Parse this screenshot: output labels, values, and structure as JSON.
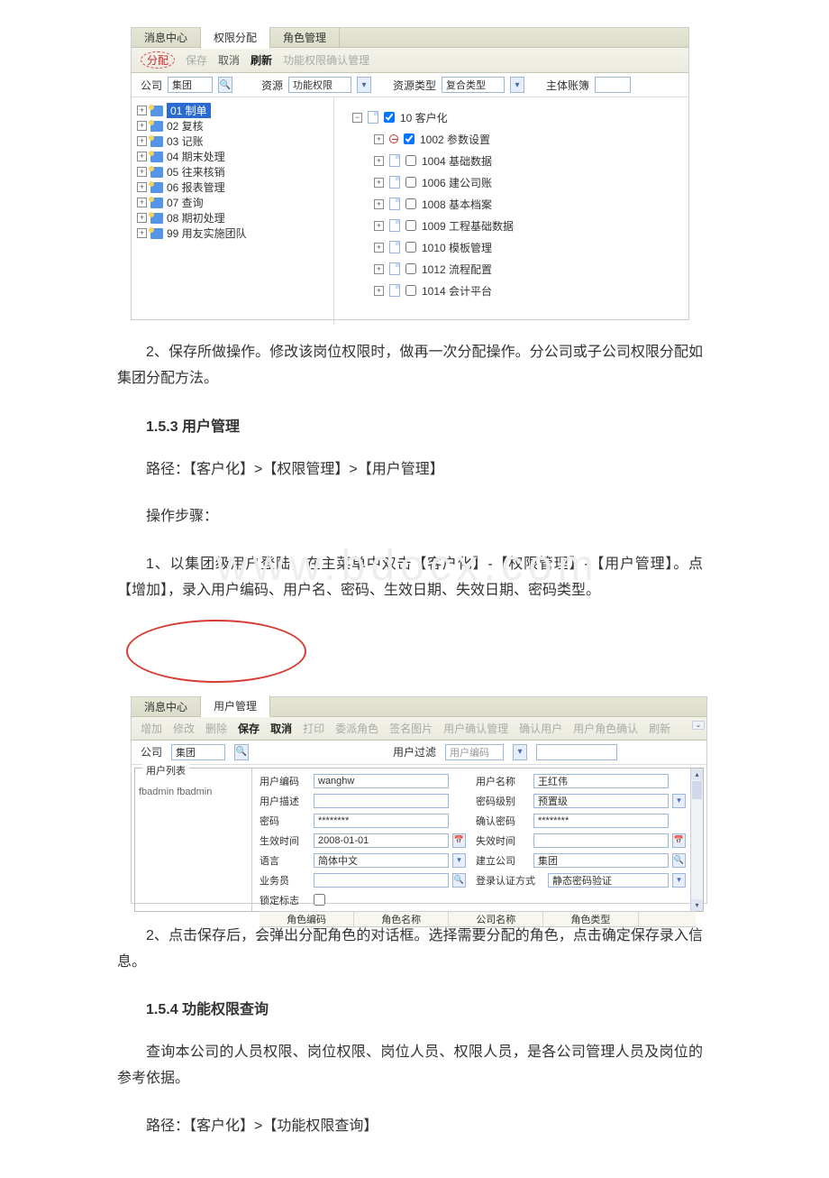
{
  "shot1": {
    "tabs": [
      "消息中心",
      "权限分配",
      "角色管理"
    ],
    "toolbar": {
      "distribute": "分配",
      "save": "保存",
      "cancel": "取消",
      "refresh": "刷新",
      "funcConfirm": "功能权限确认管理"
    },
    "filter": {
      "companyLabel": "公司",
      "companyVal": "集团",
      "resLabel": "资源",
      "resVal": "功能权限",
      "resTypeLabel": "资源类型",
      "resTypeVal": "复合类型",
      "ledgerLabel": "主体账簿"
    },
    "leftTree": [
      {
        "code": "01",
        "name": "制单",
        "sel": true
      },
      {
        "code": "02",
        "name": "复核"
      },
      {
        "code": "03",
        "name": "记账"
      },
      {
        "code": "04",
        "name": "期末处理"
      },
      {
        "code": "05",
        "name": "往来核销"
      },
      {
        "code": "06",
        "name": "报表管理"
      },
      {
        "code": "07",
        "name": "查询"
      },
      {
        "code": "08",
        "name": "期初处理"
      },
      {
        "code": "99",
        "name": "用友实施团队"
      }
    ],
    "rightTree": {
      "root": {
        "code": "10",
        "name": "客户化",
        "checked": true
      },
      "children": [
        {
          "code": "1002",
          "name": "参数设置",
          "checked": true,
          "minus": true
        },
        {
          "code": "1004",
          "name": "基础数据"
        },
        {
          "code": "1006",
          "name": "建公司账"
        },
        {
          "code": "1008",
          "name": "基本档案"
        },
        {
          "code": "1009",
          "name": "工程基础数据"
        },
        {
          "code": "1010",
          "name": "模板管理"
        },
        {
          "code": "1012",
          "name": "流程配置"
        },
        {
          "code": "1014",
          "name": "会计平台"
        }
      ]
    }
  },
  "doc": {
    "p1": "2、保存所做操作。修改该岗位权限时，做再一次分配操作。分公司或子公司权限分配如集团分配方法。",
    "h1": "1.5.3 用户管理",
    "p2": "路径：【客户化】>【权限管理】>【用户管理】",
    "p3": "操作步骤：",
    "p4": "1、以集团级用户登陆，在主菜单中双击【客户化】-【权限管理】-【用户管理】。点【增加】，录入用户编码、用户名、密码、生效日期、失效日期、密码类型。",
    "watermark": "www.bdocx.com",
    "p5": "2、点击保存后，会弹出分配角色的对话框。选择需要分配的角色，点击确定保存录入信息。",
    "h2": "1.5.4 功能权限查询",
    "p6": "查询本公司的人员权限、岗位权限、岗位人员、权限人员，是各公司管理人员及岗位的参考依据。",
    "p7": "路径：【客户化】>【功能权限查询】"
  },
  "shot2": {
    "tabs": [
      "消息中心",
      "用户管理"
    ],
    "toolbar": {
      "add": "增加",
      "edit": "修改",
      "del": "删除",
      "save": "保存",
      "cancel": "取消",
      "print": "打印",
      "assignRole": "委派角色",
      "signImg": "签名图片",
      "userConfirmMgr": "用户确认管理",
      "confirmUser": "确认用户",
      "userRoleConfirm": "用户角色确认",
      "refresh": "刷新"
    },
    "filter": {
      "companyLabel": "公司",
      "companyVal": "集团",
      "userFilterLabel": "用户过滤",
      "userFilterVal": "用户编码"
    },
    "legend": "用户列表",
    "userRow": "fbadmin  fbadmin",
    "form": {
      "userCodeL": "用户编码",
      "userCodeV": "wanghw",
      "userNameL": "用户名称",
      "userNameV": "王红伟",
      "userDescL": "用户描述",
      "userDescV": "",
      "pwdLevelL": "密码级别",
      "pwdLevelV": "预置级",
      "pwdL": "密码",
      "pwdV": "********",
      "pwd2L": "确认密码",
      "pwd2V": "********",
      "effTimeL": "生效时间",
      "effTimeV": "2008-01-01",
      "expTimeL": "失效时间",
      "expTimeV": "",
      "langL": "语言",
      "langV": "简体中文",
      "corpL": "建立公司",
      "corpV": "集团",
      "bizL": "业务员",
      "bizV": "",
      "authL": "登录认证方式",
      "authV": "静态密码验证",
      "lockL": "锁定标志"
    },
    "roleHdr": [
      "角色编码",
      "角色名称",
      "公司名称",
      "角色类型"
    ]
  }
}
